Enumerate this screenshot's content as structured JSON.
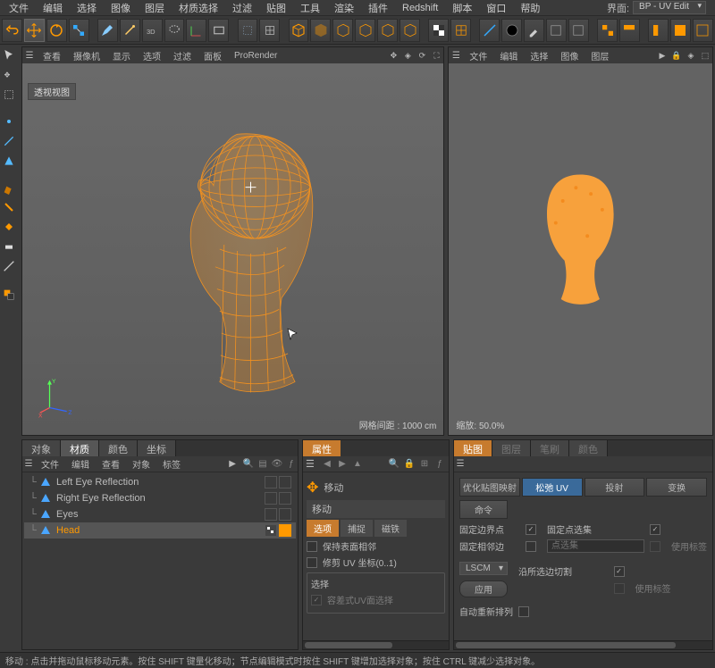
{
  "top_menu": {
    "items": [
      "文件",
      "编辑",
      "选择",
      "图像",
      "图层",
      "材质选择",
      "过滤",
      "贴图",
      "工具",
      "渲染",
      "插件",
      "Redshift",
      "脚本",
      "窗口",
      "帮助"
    ],
    "layout_label": "界面:",
    "layout_value": "BP - UV Edit"
  },
  "viewport": {
    "left": {
      "tabs": [
        "查看",
        "摄像机",
        "显示",
        "选项",
        "过滤",
        "面板",
        "ProRender"
      ],
      "label": "透视视图",
      "grid_info": "网格间距 : 1000 cm",
      "axes": {
        "x": "X",
        "y": "Y",
        "z": "Z"
      }
    },
    "right": {
      "tabs": [
        "文件",
        "编辑",
        "选择",
        "图像",
        "图层"
      ],
      "zoom_info": "缩放: 50.0%"
    }
  },
  "objects": {
    "tabs": [
      "对象",
      "材质",
      "颜色",
      "坐标"
    ],
    "subbar": [
      "文件",
      "编辑",
      "查看",
      "对象",
      "标签"
    ],
    "items": [
      {
        "name": "Left Eye Reflection",
        "selected": false,
        "tagged": false
      },
      {
        "name": "Right Eye Reflection",
        "selected": false,
        "tagged": false
      },
      {
        "name": "Eyes",
        "selected": false,
        "tagged": false
      },
      {
        "name": "Head",
        "selected": true,
        "tagged": true
      }
    ]
  },
  "attributes": {
    "tab": "属性",
    "tool_label": "移动",
    "section_title": "移动",
    "sub_tabs": [
      "选项",
      "捕捉",
      "磁铁"
    ],
    "active_sub": 0,
    "opts": {
      "keep_neighbors": "保持表面相邻",
      "trim_uv": "修剪 UV 坐标(0..1)"
    },
    "select_group": {
      "title": "选择",
      "tolerant_uv": "容差式UV面选择"
    }
  },
  "uv": {
    "tabs": [
      "贴图",
      "图层",
      "笔刷",
      "颜色"
    ],
    "mode_buttons": [
      "优化贴图映射",
      "松弛 UV",
      "投射",
      "变换"
    ],
    "active_mode": 1,
    "command_btn": "命令",
    "labels": {
      "fix_boundary": "固定边界点",
      "fix_point_sel": "固定点选集",
      "fix_adj_edge": "固定相邻边",
      "point_sel_field": "点选集",
      "use_tag": "使用标签",
      "cut_along_sel": "沿所选边切割",
      "auto_rearrange": "自动重新排列"
    },
    "dropdown_value": "LSCM",
    "apply_btn": "应用"
  },
  "statusbar": {
    "text": "移动 : 点击并拖动鼠标移动元素。按住 SHIFT 键量化移动；节点编辑模式时按住 SHIFT 键增加选择对象；按住 CTRL 键减少选择对象。"
  }
}
